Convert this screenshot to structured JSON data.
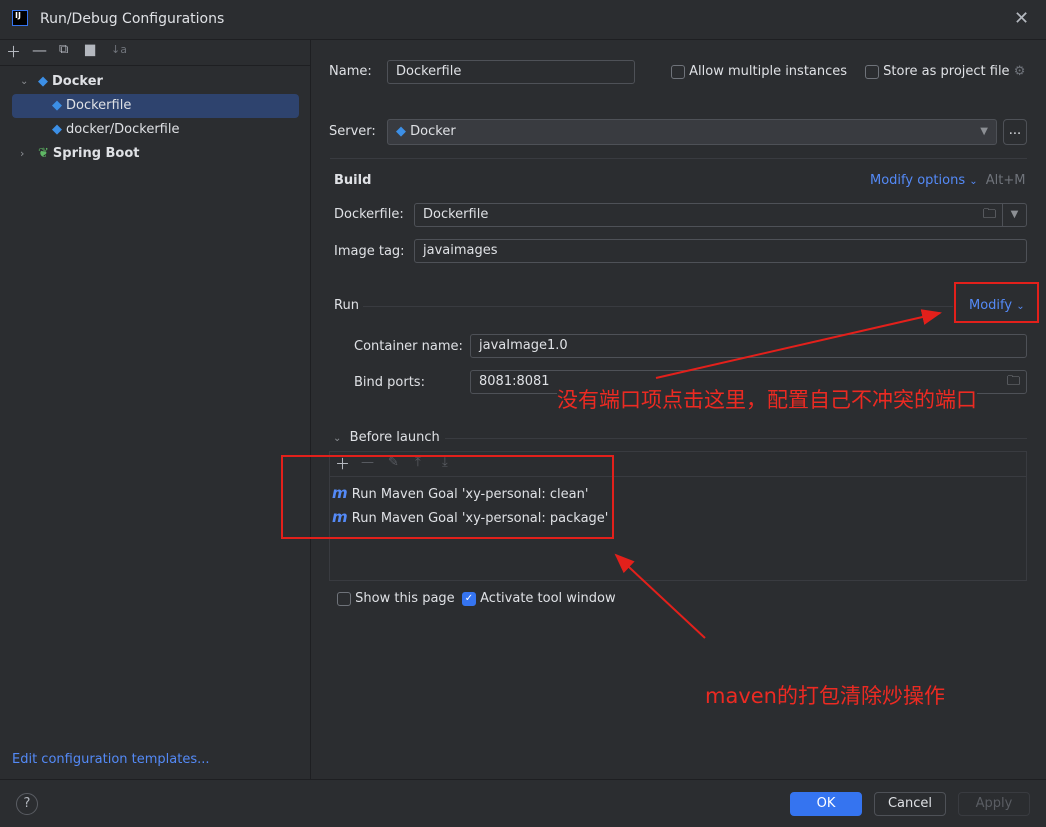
{
  "window": {
    "title": "Run/Debug Configurations",
    "logo": "IJ"
  },
  "sidebar": {
    "toolbar": [
      "add-icon",
      "remove-icon",
      "copy-icon",
      "new-folder-icon",
      "sort-icon"
    ],
    "tree": [
      {
        "label": "Docker",
        "expanded": true
      },
      {
        "label": "Dockerfile",
        "selected": true
      },
      {
        "label": "docker/Dockerfile"
      },
      {
        "label": "Spring Boot",
        "expanded": false
      }
    ],
    "edit_templates": "Edit configuration templates..."
  },
  "form": {
    "name_label": "Name:",
    "name_value": "Dockerfile",
    "allow_multiple": "Allow multiple instances",
    "allow_multiple_checked": false,
    "store_project": "Store as project file",
    "store_project_checked": false,
    "server_label": "Server:",
    "server_value": "Docker",
    "more": "...",
    "build_title": "Build",
    "modify_options": "Modify options",
    "modify_shortcut": "Alt+M",
    "dockerfile_label": "Dockerfile:",
    "dockerfile_value": "Dockerfile",
    "image_tag_label": "Image tag:",
    "image_tag_value": "javaimages",
    "run_title": "Run",
    "modify": "Modify",
    "container_label": "Container name:",
    "container_value": "javaImage1.0",
    "ports_label": "Bind ports:",
    "ports_value": "8081:8081",
    "before_launch": "Before launch",
    "tasks": [
      "Run Maven Goal 'xy-personal: clean'",
      "Run Maven Goal 'xy-personal: package'"
    ],
    "maven_icon": "m",
    "show_page": "Show this page",
    "show_page_checked": false,
    "activate_tool": "Activate tool window",
    "activate_tool_checked": true
  },
  "footer": {
    "help": "?",
    "ok": "OK",
    "cancel": "Cancel",
    "apply": "Apply"
  },
  "annotations": {
    "modify_note": "没有端口项点击这里，配置自己不冲突的端口",
    "maven_note": "maven的打包清除炒操作",
    "color": "#e3201b"
  }
}
